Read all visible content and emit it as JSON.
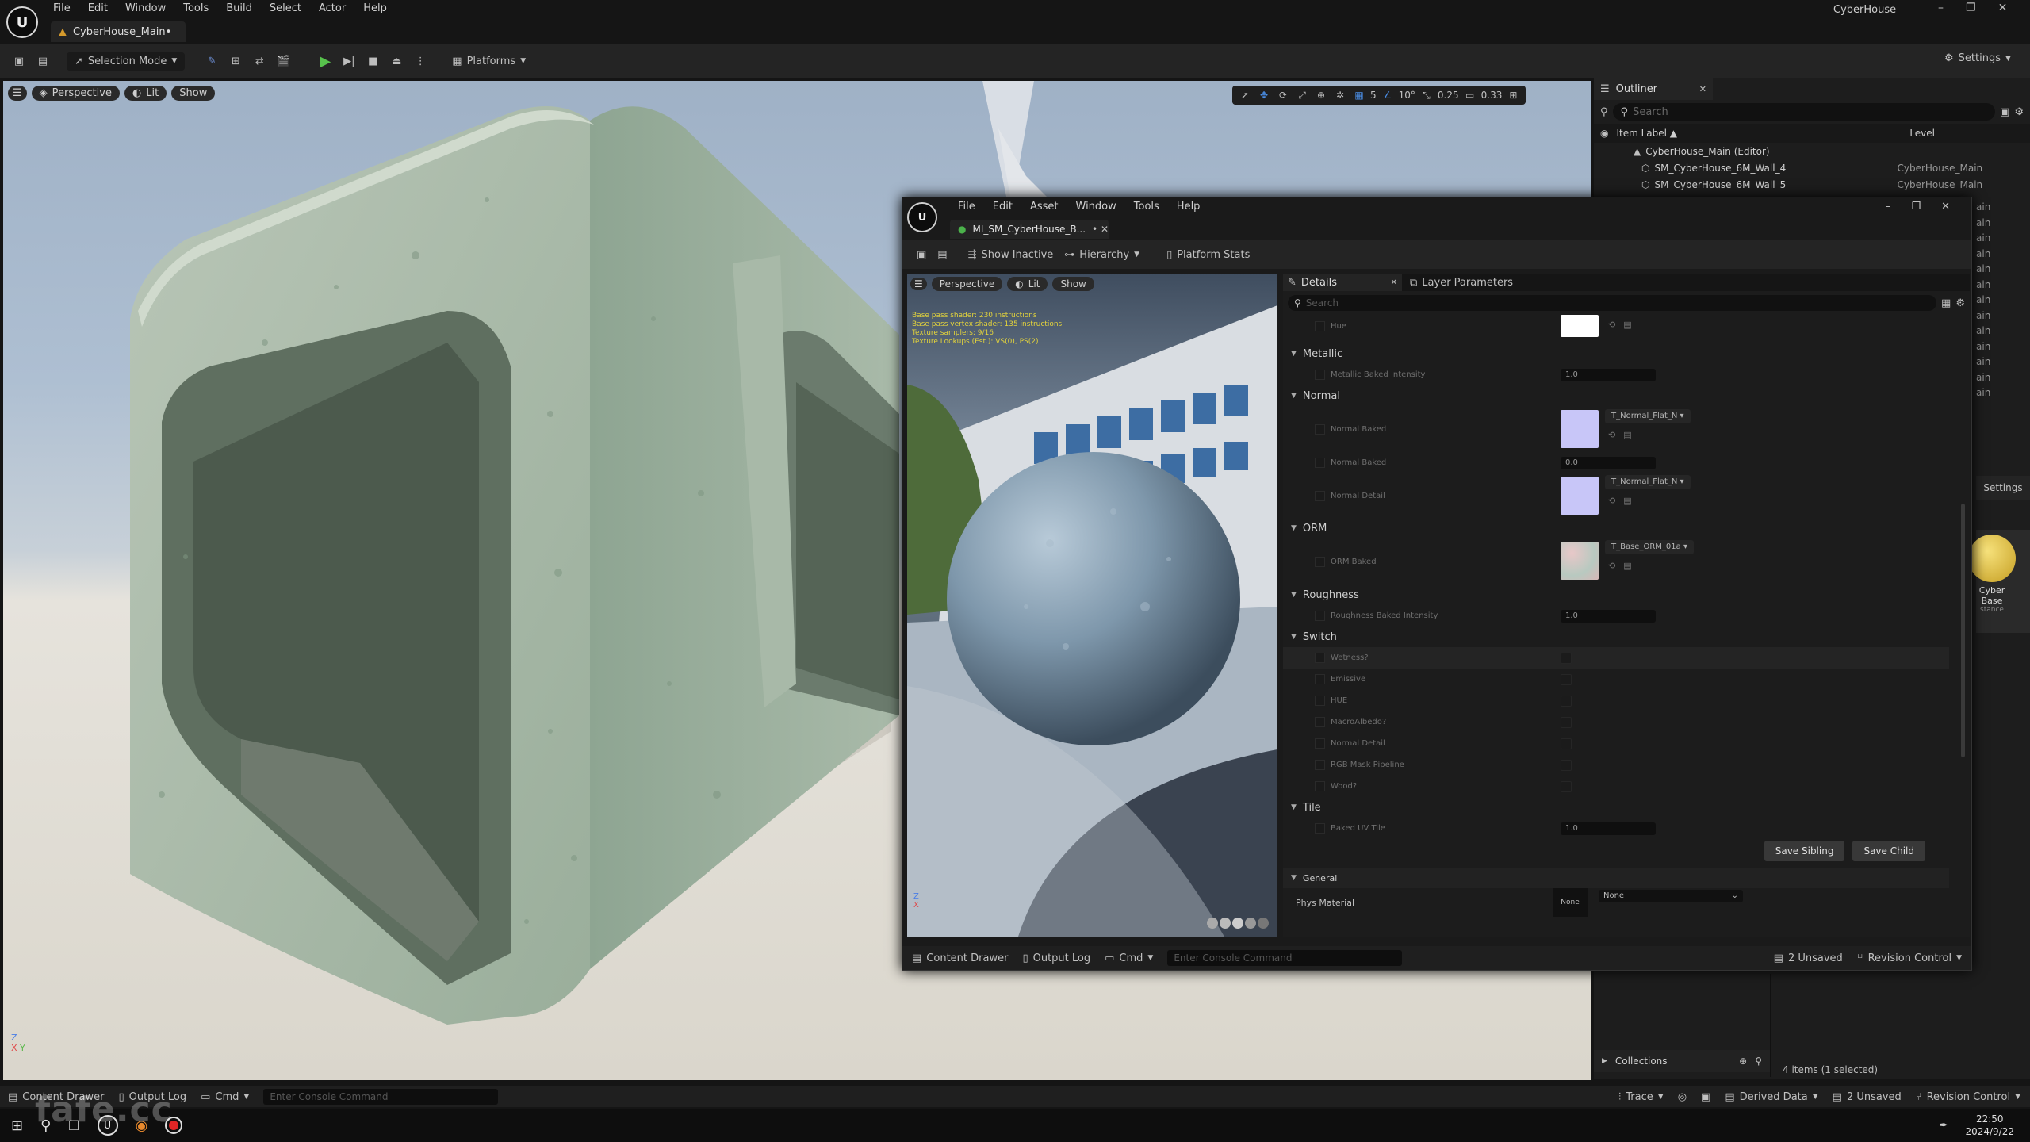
{
  "app": {
    "title": "CyberHouse",
    "tab_label": "CyberHouse_Main•",
    "menu": [
      "File",
      "Edit",
      "Window",
      "Tools",
      "Build",
      "Select",
      "Actor",
      "Help"
    ]
  },
  "toolbar": {
    "selection_mode": "Selection Mode",
    "platforms": "Platforms",
    "settings": "Settings"
  },
  "viewport": {
    "perspective": "Perspective",
    "lit": "Lit",
    "show": "Show",
    "grid_value": "5",
    "angle_value": "10°",
    "scale_value": "0.25",
    "camera_value": "0.33"
  },
  "outliner": {
    "title": "Outliner",
    "search_placeholder": "Search",
    "col_label": "Item Label ▲",
    "col_level": "Level",
    "rows": [
      {
        "label": "CyberHouse_Main (Editor)",
        "level": ""
      },
      {
        "label": "SM_CyberHouse_6M_Wall_4",
        "level": "CyberHouse_Main"
      },
      {
        "label": "SM_CyberHouse_6M_Wall_5",
        "level": "CyberHouse_Main"
      }
    ],
    "behind_rows": [
      "ain",
      "ain",
      "ain",
      "ain",
      "ain",
      "ain",
      "ain",
      "ain",
      "ain",
      "ain",
      "ain",
      "ain",
      "ain"
    ],
    "settings": "Settings",
    "asset_name": "Cyber Base",
    "asset_type": "stance",
    "collections": "Collections",
    "items_count": "4 items (1 selected)"
  },
  "editor": {
    "menu": [
      "File",
      "Edit",
      "Asset",
      "Window",
      "Tools",
      "Help"
    ],
    "tab": "MI_SM_CyberHouse_B...",
    "toolbar": {
      "show_inactive": "Show Inactive",
      "hierarchy": "Hierarchy",
      "platform_stats": "Platform Stats"
    },
    "preview": {
      "perspective": "Perspective",
      "lit": "Lit",
      "show": "Show",
      "stats": [
        "Base pass shader: 230 instructions",
        "Base pass vertex shader: 135 instructions",
        "Texture samplers: 9/16",
        "Texture Lookups (Est.): VS(0), PS(2)"
      ]
    },
    "details_tab": "Details",
    "layer_tab": "Layer Parameters",
    "search_placeholder": "Search",
    "sections": {
      "hue_row": "Hue",
      "metallic": "Metallic",
      "metallic_baked": "Metallic Baked Intensity",
      "metallic_val": "1.0",
      "normal": "Normal",
      "normal_baked": "Normal Baked",
      "normal_tex": "T_Normal_Flat_N",
      "normal_baked2": "Normal Baked",
      "normal_val": "0.0",
      "normal_detail": "Normal Detail",
      "normal_tex2": "T_Normal_Flat_N",
      "orm": "ORM",
      "orm_baked": "ORM Baked",
      "orm_tex": "T_Base_ORM_01a",
      "roughness": "Roughness",
      "roughness_baked": "Roughness Baked Intensity",
      "roughness_val": "1.0",
      "switch": "Switch",
      "switch_items": [
        "Wetness?",
        "Emissive",
        "HUE",
        "MacroAlbedo?",
        "Normal Detail",
        "RGB Mask Pipeline",
        "Wood?"
      ],
      "tile": "Tile",
      "tile_uv": "Baked UV Tile",
      "tile_val": "1.0",
      "save_sibling": "Save Sibling",
      "save_child": "Save Child",
      "general": "General",
      "phys_material": "Phys Material",
      "phys_none": "None",
      "phys_select": "None"
    },
    "footer": {
      "content_drawer": "Content Drawer",
      "output_log": "Output Log",
      "cmd": "Cmd",
      "console_placeholder": "Enter Console Command",
      "unsaved": "2 Unsaved",
      "revision": "Revision Control"
    }
  },
  "statusbar": {
    "content_drawer": "Content Drawer",
    "output_log": "Output Log",
    "cmd": "Cmd",
    "console_placeholder": "Enter Console Command",
    "trace": "Trace",
    "derived_data": "Derived Data",
    "unsaved": "2 Unsaved",
    "revision": "Revision Control"
  },
  "taskbar": {
    "time": "22:50",
    "date": "2024/9/22"
  },
  "watermark": "fafe.cc"
}
